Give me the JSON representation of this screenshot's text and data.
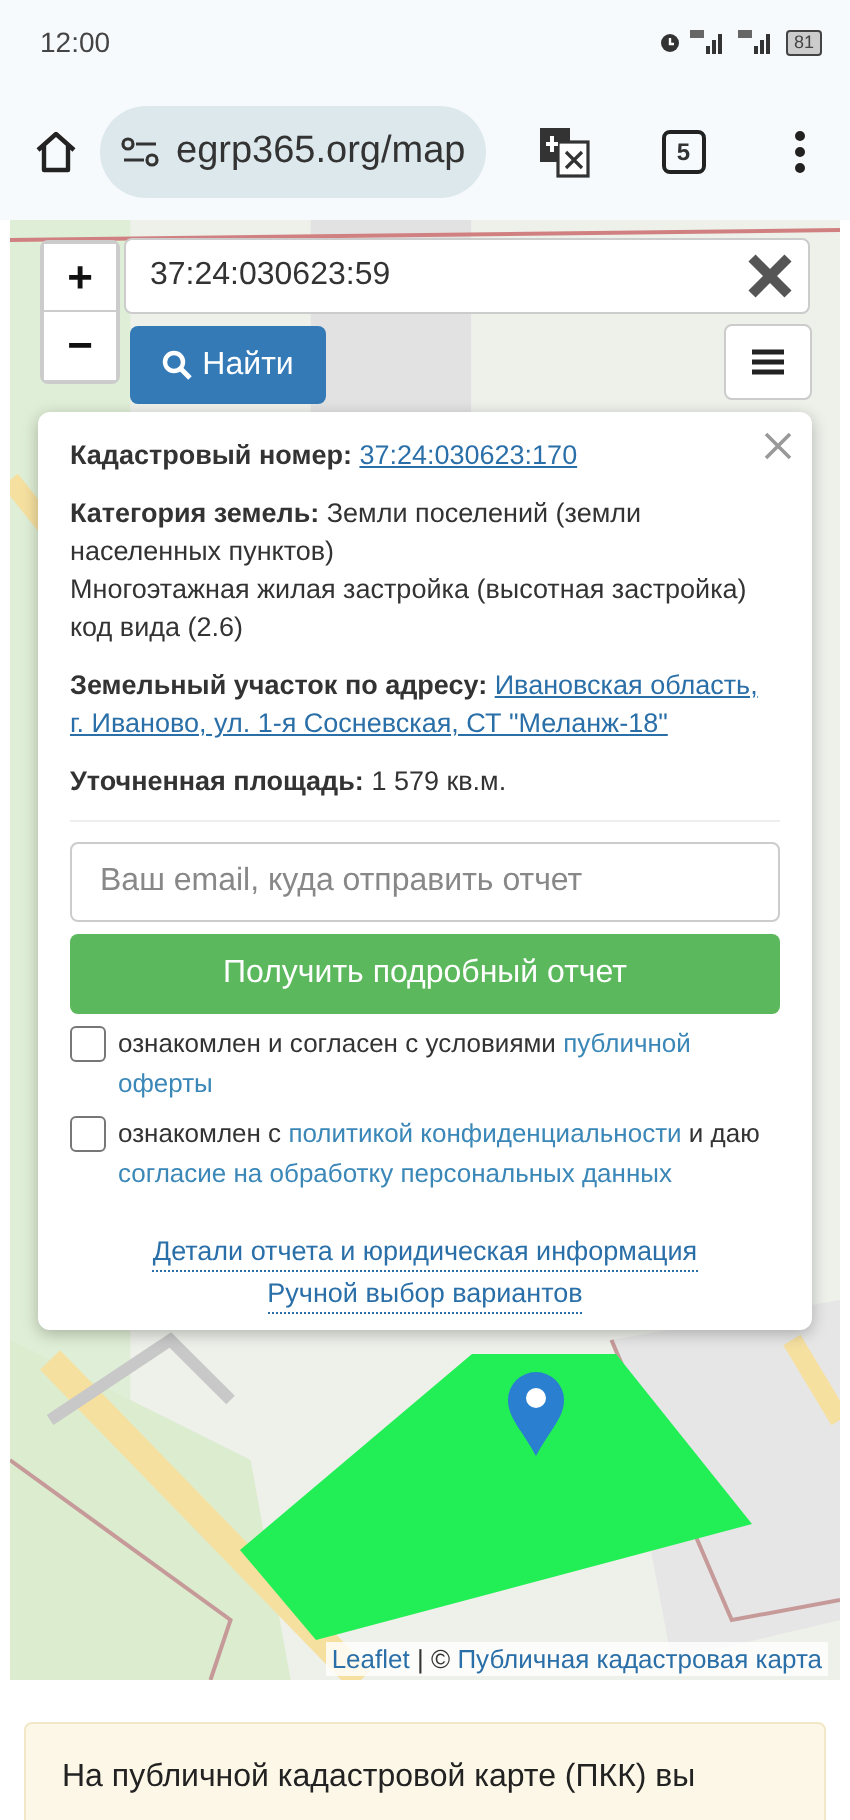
{
  "status_bar": {
    "time": "12:00",
    "battery": "81"
  },
  "browser": {
    "url": "egrp365.org/map",
    "tab_count": "5"
  },
  "map": {
    "search": {
      "value": "37:24:030623:59"
    },
    "zoom_in": "+",
    "zoom_out": "−",
    "find_button": "Найти",
    "info_panel": {
      "rows": [
        {
          "label": "Кадастровый номер:",
          "value": "37:24:030623:170",
          "kind": "link"
        },
        {
          "label": "Категория земель:",
          "value": "Земли поселений (земли населенных пунктов)",
          "kind": "text",
          "note": "Многоэтажная жилая застройка (высотная застройка) код вида (2.6)"
        },
        {
          "label": "Земельный участок по адресу:",
          "value": "Ивановская область,",
          "kind": "link",
          "value_2": "г. Иваново, ул. 1-я Сосневская, СТ \"Меланж-18\""
        },
        {
          "label": "Уточненная площадь:",
          "value": "1 579 кв.м.",
          "kind": "text"
        }
      ],
      "email": {
        "placeholder": "Ваш email, куда отправить отчет"
      },
      "submit_button": "Получить подробный отчет",
      "consents": [
        {
          "checked": false,
          "parts": [
            {
              "kind": "text",
              "text": "ознакомлен и согласен с условиями"
            },
            {
              "kind": "link",
              "text": "публичной"
            },
            {
              "kind": "link",
              "text": "оферты"
            }
          ]
        },
        {
          "checked": false,
          "parts": [
            {
              "kind": "text",
              "text": "ознакомлен с"
            },
            {
              "kind": "link",
              "text": "политикой конфиденциальности"
            },
            {
              "kind": "text",
              "text": "и даю"
            },
            {
              "kind": "link",
              "text": "согласие на обработку персональных данных"
            }
          ]
        }
      ],
      "footer_links": [
        "Детали отчета и юридическая информация",
        "Ручной выбор вариантов"
      ]
    },
    "attribution": [
      {
        "kind": "link",
        "text": "Leaflet"
      },
      {
        "kind": "text",
        "text": "| ©"
      },
      {
        "kind": "link",
        "text": "Публичная кадастровая карта"
      }
    ]
  },
  "notice": {
    "text": "На публичной кадастровой карте (ПКК) вы"
  }
}
